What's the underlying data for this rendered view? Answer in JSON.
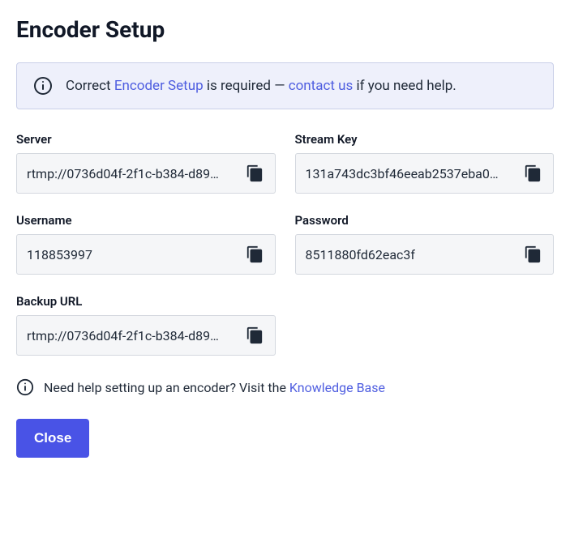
{
  "title": "Encoder Setup",
  "banner": {
    "pre": "Correct ",
    "link1": "Encoder Setup",
    "mid": " is required — ",
    "link2": "contact us",
    "post": " if you need help."
  },
  "fields": {
    "server": {
      "label": "Server",
      "value": "rtmp://0736d04f-2f1c-b384-d89…"
    },
    "streamKey": {
      "label": "Stream Key",
      "value": "131a743dc3bf46eeab2537eba0…"
    },
    "username": {
      "label": "Username",
      "value": "118853997"
    },
    "password": {
      "label": "Password",
      "value": "8511880fd62eac3f"
    },
    "backup": {
      "label": "Backup URL",
      "value": "rtmp://0736d04f-2f1c-b384-d89…"
    }
  },
  "hint": {
    "pre": "Need help setting up an encoder? Visit the ",
    "link": "Knowledge Base"
  },
  "close": "Close"
}
